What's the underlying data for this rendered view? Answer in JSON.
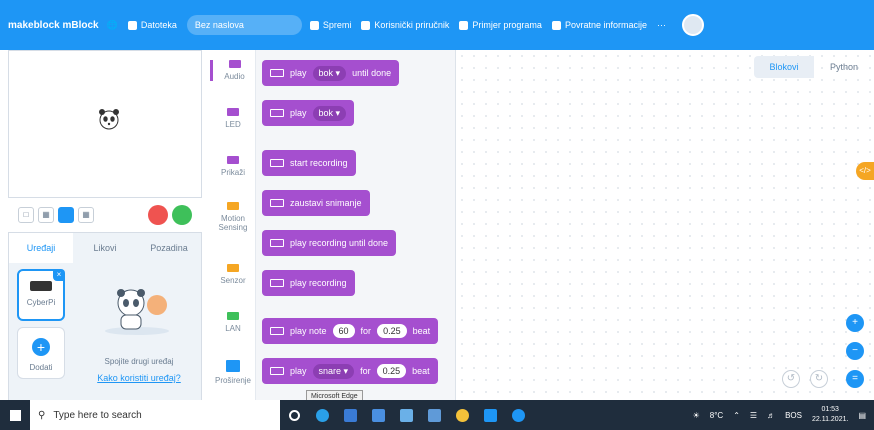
{
  "topbar": {
    "brand": "makeblock mBlock",
    "file_menu": "Datoteka",
    "project_name": "Bez naslova",
    "save": "Spremi",
    "manual": "Korisnički priručnik",
    "examples": "Primjer programa",
    "feedback": "Povratne informacije",
    "more": "···"
  },
  "devices_tabs": [
    "Uređaji",
    "Likovi",
    "Pozadina"
  ],
  "device": {
    "name": "CyberPi",
    "add_label": "Dodati"
  },
  "empty_state": {
    "text": "Spojite drugi uređaj",
    "link": "Kako koristiti uređaj?"
  },
  "categories": [
    {
      "label": "Audio",
      "color": "#a54fcf"
    },
    {
      "label": "LED",
      "color": "#a54fcf"
    },
    {
      "label": "Prikaži",
      "color": "#a54fcf"
    },
    {
      "label": "Motion Sensing",
      "color": "#f5a623"
    },
    {
      "label": "Senzor",
      "color": "#f5a623"
    },
    {
      "label": "LAN",
      "color": "#3ec05a"
    },
    {
      "label": "Proširenje",
      "color": "#1e96f5"
    }
  ],
  "blocks": [
    {
      "prefix": "play",
      "dropdown": "bok",
      "suffix": "until done"
    },
    {
      "prefix": "play",
      "dropdown": "bok"
    },
    {
      "prefix": "start recording"
    },
    {
      "prefix": "zaustavi snimanje"
    },
    {
      "prefix": "play recording until done"
    },
    {
      "prefix": "play recording"
    },
    {
      "prefix": "play note",
      "num1": "60",
      "mid": "for",
      "num2": "0.25",
      "suffix": "beat"
    },
    {
      "prefix": "play",
      "dropdown": "snare",
      "mid": "for",
      "num2": "0.25",
      "suffix": "beat"
    }
  ],
  "code_tabs": [
    "Blokovi",
    "Python"
  ],
  "code_toggle": "</>",
  "taskbar": {
    "search_placeholder": "Type here to search",
    "tooltip": "Microsoft Edge",
    "temperature": "8°C",
    "lang": "BOS",
    "time": "01:53",
    "date": "22.11.2021."
  },
  "colors": {
    "accent": "#1e96f5",
    "block": "#a54fcf",
    "stop": "#ef5350",
    "go": "#3ec05a"
  }
}
